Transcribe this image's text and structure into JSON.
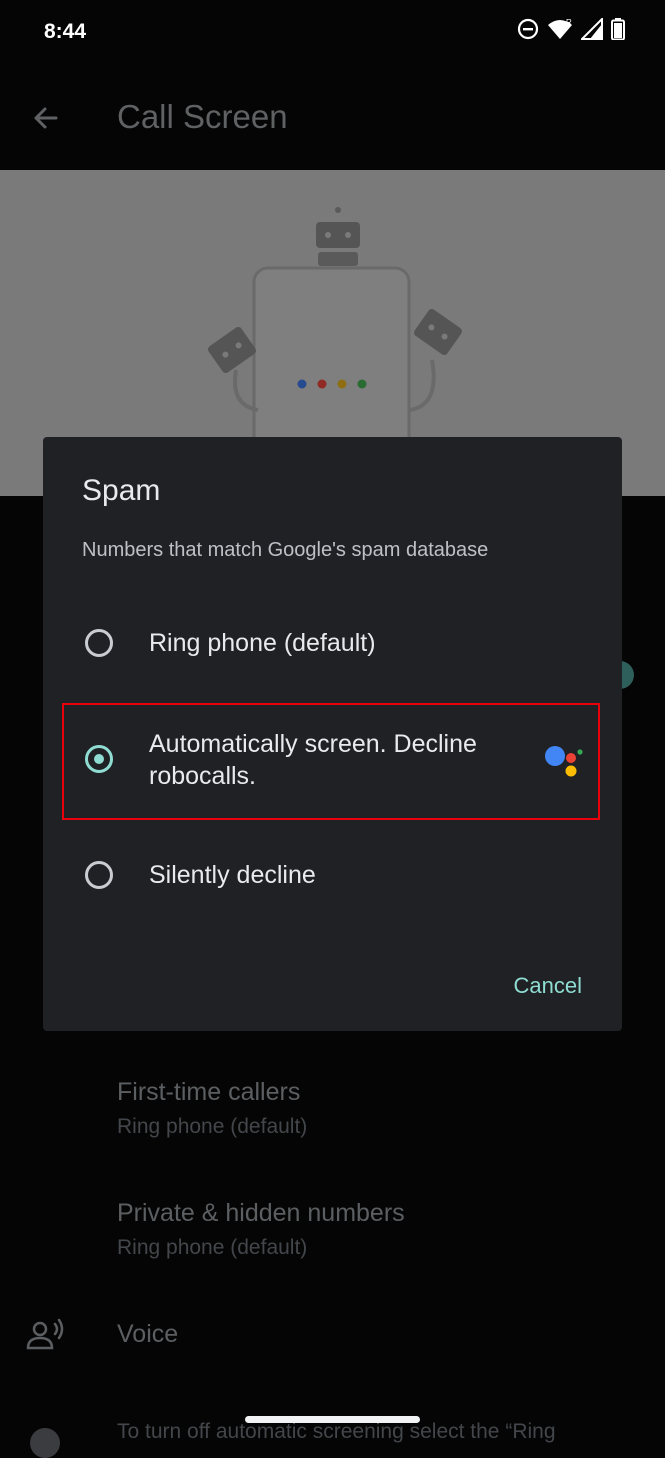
{
  "status": {
    "time": "8:44"
  },
  "appbar": {
    "title": "Call Screen"
  },
  "dialog": {
    "title": "Spam",
    "subtitle": "Numbers that match Google's spam database",
    "options": [
      {
        "label": "Ring phone (default)",
        "checked": false
      },
      {
        "label": "Automatically screen. Decline robocalls.",
        "checked": true
      },
      {
        "label": "Silently decline",
        "checked": false
      }
    ],
    "cancel": "Cancel"
  },
  "settings": {
    "first_time": {
      "title": "First-time callers",
      "value": "Ring phone (default)"
    },
    "private": {
      "title": "Private & hidden numbers",
      "value": "Ring phone (default)"
    },
    "voice": {
      "title": "Voice"
    },
    "footer_text": "To turn off automatic screening select the “Ring"
  },
  "colors": {
    "accent": "#8fdcd3",
    "highlight": "#e8000d",
    "dialog_bg": "#202124"
  },
  "icons": [
    "do-not-disturb-icon",
    "wifi-icon",
    "signal-icon",
    "battery-icon",
    "back-arrow-icon",
    "google-assistant-icon",
    "voice-icon"
  ]
}
